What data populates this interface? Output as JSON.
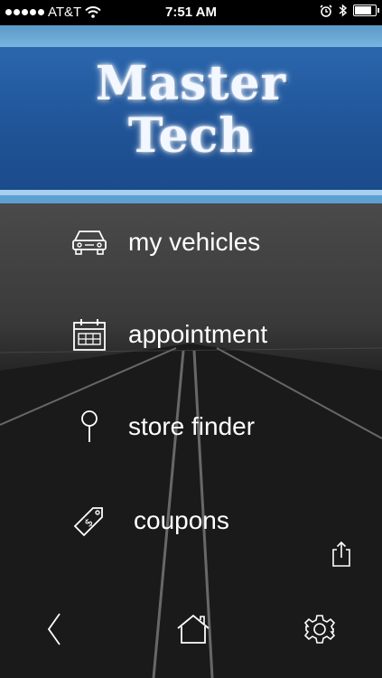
{
  "status_bar": {
    "carrier": "AT&T",
    "time": "7:51 AM",
    "signal_bars": 5,
    "battery_level": 0.9
  },
  "banner": {
    "logo_line1": "Master",
    "logo_line2": "Tech"
  },
  "menu": {
    "items": [
      {
        "label": "my vehicles",
        "icon": "car-icon"
      },
      {
        "label": "appointment",
        "icon": "calendar-icon"
      },
      {
        "label": "store finder",
        "icon": "map-pin-icon"
      },
      {
        "label": "coupons",
        "icon": "price-tag-icon"
      }
    ]
  },
  "toolbar": {
    "share_icon": "share-icon"
  },
  "tab_bar": {
    "items": [
      {
        "icon": "back-chevron-icon"
      },
      {
        "icon": "home-icon"
      },
      {
        "icon": "gear-icon"
      }
    ]
  },
  "colors": {
    "banner_blue": "#1f5396",
    "banner_light_blue": "#6fa9d6"
  }
}
